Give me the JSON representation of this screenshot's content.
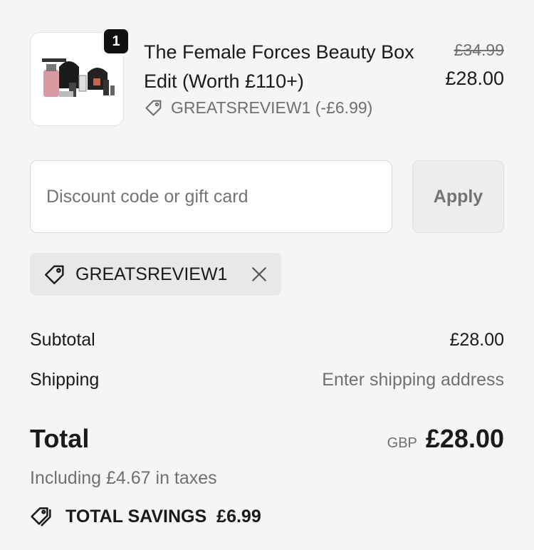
{
  "product": {
    "quantity": "1",
    "name": "The Female Forces Beauty Box Edit (Worth £110+)",
    "original_price": "£34.99",
    "price": "£28.00",
    "discount_line": "GREATSREVIEW1 (-£6.99)"
  },
  "discount": {
    "placeholder": "Discount code or gift card",
    "value": "",
    "apply_label": "Apply",
    "applied_code": "GREATSREVIEW1"
  },
  "summary": {
    "subtotal_label": "Subtotal",
    "subtotal_value": "£28.00",
    "shipping_label": "Shipping",
    "shipping_value": "Enter shipping address",
    "total_label": "Total",
    "currency": "GBP",
    "total_value": "£28.00",
    "tax_note": "Including £4.67 in taxes",
    "savings_label": "TOTAL SAVINGS",
    "savings_value": "£6.99"
  },
  "icons": {
    "tag": "tag-icon",
    "remove": "close-icon",
    "savings": "tags-icon"
  }
}
